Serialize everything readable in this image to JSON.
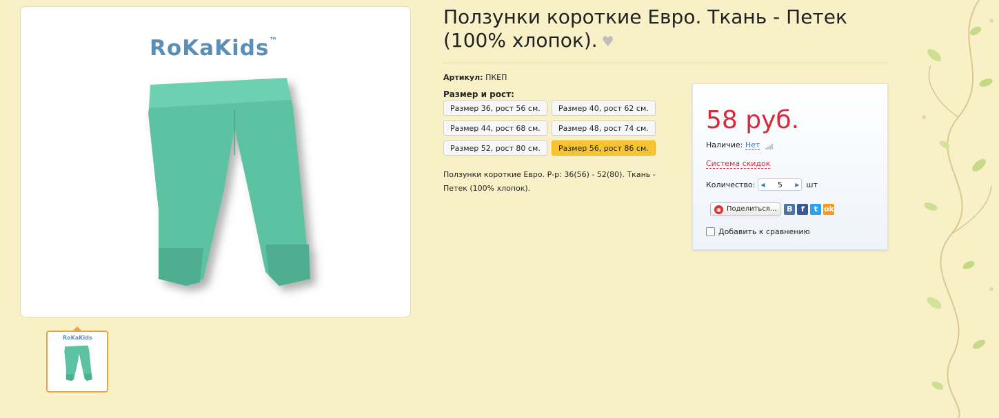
{
  "product": {
    "title": "Ползунки короткие Евро. Ткань - Петек (100% хлопок).",
    "brand_logo": "RoKaKids",
    "brand_tm": "™",
    "sku_label": "Артикул:",
    "sku_value": "ПКЕП",
    "size_label": "Размер и рост:",
    "sizes": [
      "Размер 36, рост 56 см.",
      "Размер 40, рост 62 см.",
      "Размер 44, рост 68 см.",
      "Размер 48, рост 74 см.",
      "Размер 52, рост 80 см.",
      "Размер 56, рост 86 см."
    ],
    "selected_size_index": 5,
    "description": "Ползунки короткие Евро. Р-р: 36(56) - 52(80). Ткань - Петек (100% хлопок)."
  },
  "buy_box": {
    "price": "58 руб.",
    "availability_label": "Наличие:",
    "availability_value": "Нет",
    "discount_link": "Система скидок",
    "quantity_label": "Количество:",
    "quantity_value": "5",
    "quantity_unit": "шт",
    "share_label": "Поделиться...",
    "social": [
      "В",
      "f",
      "t",
      "ok"
    ],
    "compare_label": "Добавить к сравнению"
  },
  "colors": {
    "background": "#f8f0c7",
    "price": "#d6293b",
    "active_size": "#f6c433",
    "link": "#3a7db8",
    "garment": "#5cc2a2",
    "thumb_border": "#f0a23c"
  }
}
